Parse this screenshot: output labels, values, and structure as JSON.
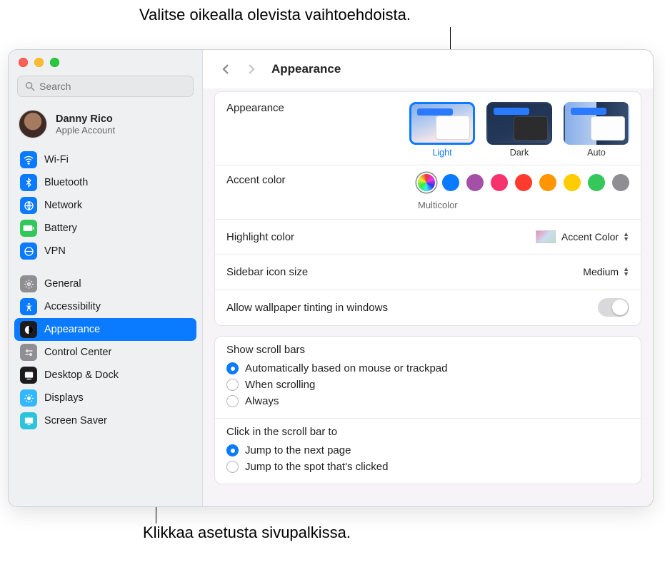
{
  "callouts": {
    "top": "Valitse oikealla olevista vaihtoehdoista.",
    "bottom": "Klikkaa asetusta sivupalkissa."
  },
  "search": {
    "placeholder": "Search"
  },
  "account": {
    "name": "Danny Rico",
    "sub": "Apple Account"
  },
  "sidebar": {
    "group1": [
      {
        "label": "Wi-Fi",
        "bg": "#0a7aff"
      },
      {
        "label": "Bluetooth",
        "bg": "#0a7aff"
      },
      {
        "label": "Network",
        "bg": "#0a7aff"
      },
      {
        "label": "Battery",
        "bg": "#33c759"
      },
      {
        "label": "VPN",
        "bg": "#0a7aff"
      }
    ],
    "group2": [
      {
        "label": "General",
        "bg": "#8e8e93"
      },
      {
        "label": "Accessibility",
        "bg": "#0a7aff"
      },
      {
        "label": "Appearance",
        "bg": "#1c1c1e"
      },
      {
        "label": "Control Center",
        "bg": "#8e8e93"
      },
      {
        "label": "Desktop & Dock",
        "bg": "#1c1c1e"
      },
      {
        "label": "Displays",
        "bg": "#33b7ff"
      },
      {
        "label": "Screen Saver",
        "bg": "#2cc4db"
      }
    ],
    "selected_label": "Appearance"
  },
  "toolbar": {
    "title": "Appearance"
  },
  "appearance_row": {
    "label": "Appearance",
    "options": [
      {
        "label": "Light",
        "selected": true,
        "cls": "th-light"
      },
      {
        "label": "Dark",
        "selected": false,
        "cls": "th-dark"
      },
      {
        "label": "Auto",
        "selected": false,
        "cls": "th-auto"
      }
    ]
  },
  "accent": {
    "label": "Accent color",
    "caption": "Multicolor",
    "colors": [
      {
        "multi": true,
        "hex": ""
      },
      {
        "multi": false,
        "hex": "#0a7aff"
      },
      {
        "multi": false,
        "hex": "#a550a7"
      },
      {
        "multi": false,
        "hex": "#f6336f"
      },
      {
        "multi": false,
        "hex": "#ff3b30"
      },
      {
        "multi": false,
        "hex": "#ff9500"
      },
      {
        "multi": false,
        "hex": "#ffcc00"
      },
      {
        "multi": false,
        "hex": "#34c759"
      },
      {
        "multi": false,
        "hex": "#8e8e93"
      }
    ]
  },
  "highlight": {
    "label": "Highlight color",
    "value": "Accent Color"
  },
  "sidebar_size": {
    "label": "Sidebar icon size",
    "value": "Medium"
  },
  "tint": {
    "label": "Allow wallpaper tinting in windows",
    "on": false
  },
  "scrollbars": {
    "title": "Show scroll bars",
    "options": [
      {
        "label": "Automatically based on mouse or trackpad",
        "on": true
      },
      {
        "label": "When scrolling",
        "on": false
      },
      {
        "label": "Always",
        "on": false
      }
    ]
  },
  "scrollclick": {
    "title": "Click in the scroll bar to",
    "options": [
      {
        "label": "Jump to the next page",
        "on": true
      },
      {
        "label": "Jump to the spot that's clicked",
        "on": false
      }
    ]
  }
}
